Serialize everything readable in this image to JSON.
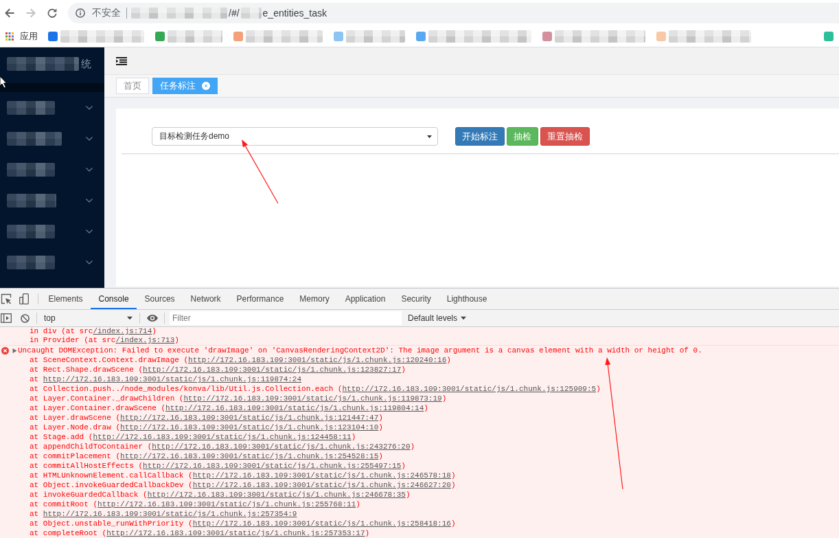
{
  "browser": {
    "security_label": "不安全",
    "url_segments": [
      {
        "kind": "redacted"
      },
      {
        "kind": "text",
        "text": "/#/"
      },
      {
        "kind": "redacted"
      },
      {
        "kind": "text",
        "text": "e_entities_task"
      }
    ],
    "bookmarks": [
      {
        "kind": "apps",
        "label": "应用"
      },
      {
        "kind": "redacted",
        "color": "#1a73e8"
      },
      {
        "kind": "redacted",
        "color": "#34a853"
      },
      {
        "kind": "redacted",
        "color": "#f4a07a"
      },
      {
        "kind": "redacted",
        "color": "#8cc4f4"
      },
      {
        "kind": "redacted",
        "color": "#5aa9f0"
      },
      {
        "kind": "redacted",
        "color": "#d4909c"
      },
      {
        "kind": "redacted",
        "color": "#f8c9a8"
      },
      {
        "kind": "icon_only",
        "color": "#2dbf9a"
      }
    ]
  },
  "sidebar": {
    "title_segments": [
      {
        "kind": "redacted"
      },
      {
        "kind": "text",
        "text": "统"
      }
    ],
    "menu": [
      {
        "kind": "redacted",
        "expanded": false
      },
      {
        "kind": "redacted",
        "expanded": false
      },
      {
        "kind": "redacted",
        "expanded": false
      },
      {
        "kind": "redacted",
        "expanded": false
      },
      {
        "kind": "redacted",
        "expanded": false
      },
      {
        "kind": "redacted",
        "expanded": false
      }
    ]
  },
  "page_tabs": [
    {
      "label": "首页",
      "selected": false,
      "closable": false
    },
    {
      "label": "任务标注",
      "selected": true,
      "closable": true
    }
  ],
  "task_select": {
    "value": "目标检测任务demo"
  },
  "actions": [
    {
      "label": "开始标注",
      "kind": "primary"
    },
    {
      "label": "抽检",
      "kind": "success"
    },
    {
      "label": "重置抽检",
      "kind": "danger"
    }
  ],
  "devtools": {
    "tabs": [
      {
        "label": "Elements",
        "selected": false
      },
      {
        "label": "Console",
        "selected": true
      },
      {
        "label": "Sources",
        "selected": false
      },
      {
        "label": "Network",
        "selected": false
      },
      {
        "label": "Performance",
        "selected": false
      },
      {
        "label": "Memory",
        "selected": false
      },
      {
        "label": "Application",
        "selected": false
      },
      {
        "label": "Security",
        "selected": false
      },
      {
        "label": "Lighthouse",
        "selected": false
      }
    ],
    "context": "top",
    "filter": {
      "placeholder": "Filter"
    },
    "levels": "Default levels",
    "console": {
      "previous_lines": [
        {
          "prefix": "in div (at src",
          "link": "/index.js:714",
          "suffix": ")"
        },
        {
          "prefix": "in Provider (at src",
          "link": "/index.js:713",
          "suffix": ")"
        }
      ],
      "error": {
        "expanded": false,
        "message": "Uncaught DOMException: Failed to execute 'drawImage' on 'CanvasRenderingContext2D': The image argument is a canvas element with a width or height of 0."
      },
      "stack": [
        {
          "prefix": "at SceneContext.Context.drawImage (",
          "link": "http://172.16.183.109:3001/static/js/1.chunk.js:120240:16",
          "suffix": ")"
        },
        {
          "prefix": "at Rect.Shape.drawScene (",
          "link": "http://172.16.183.109:3001/static/js/1.chunk.js:123827:17",
          "suffix": ")"
        },
        {
          "prefix": "at ",
          "link": "http://172.16.183.109:3001/static/js/1.chunk.js:119874:24"
        },
        {
          "prefix": "at Collection.push../node_modules/konva/lib/Util.js.Collection.each (",
          "link": "http://172.16.183.109:3001/static/js/1.chunk.js:125909:5",
          "suffix": ")"
        },
        {
          "prefix": "at Layer.Container._drawChildren (",
          "link": "http://172.16.183.109:3001/static/js/1.chunk.js:119873:19",
          "suffix": ")"
        },
        {
          "prefix": "at Layer.Container.drawScene (",
          "link": "http://172.16.183.109:3001/static/js/1.chunk.js:119804:14",
          "suffix": ")"
        },
        {
          "prefix": "at Layer.drawScene (",
          "link": "http://172.16.183.109:3001/static/js/1.chunk.js:121447:47",
          "suffix": ")"
        },
        {
          "prefix": "at Layer.Node.draw (",
          "link": "http://172.16.183.109:3001/static/js/1.chunk.js:123104:10",
          "suffix": ")"
        },
        {
          "prefix": "at Stage.add (",
          "link": "http://172.16.183.109:3001/static/js/1.chunk.js:124458:11",
          "suffix": ")"
        },
        {
          "prefix": "at appendChildToContainer (",
          "link": "http://172.16.183.109:3001/static/js/1.chunk.js:243276:20",
          "suffix": ")"
        },
        {
          "prefix": "at commitPlacement (",
          "link": "http://172.16.183.109:3001/static/js/1.chunk.js:254528:15",
          "suffix": ")"
        },
        {
          "prefix": "at commitAllHostEffects (",
          "link": "http://172.16.183.109:3001/static/js/1.chunk.js:255497:15",
          "suffix": ")"
        },
        {
          "prefix": "at HTMLUnknownElement.callCallback (",
          "link": "http://172.16.183.109:3001/static/js/1.chunk.js:246578:18",
          "suffix": ")"
        },
        {
          "prefix": "at Object.invokeGuardedCallbackDev (",
          "link": "http://172.16.183.109:3001/static/js/1.chunk.js:246627:20",
          "suffix": ")"
        },
        {
          "prefix": "at invokeGuardedCallback (",
          "link": "http://172.16.183.109:3001/static/js/1.chunk.js:246678:35",
          "suffix": ")"
        },
        {
          "prefix": "at commitRoot (",
          "link": "http://172.16.183.109:3001/static/js/1.chunk.js:255768:11",
          "suffix": ")"
        },
        {
          "prefix": "at ",
          "link": "http://172.16.183.109:3001/static/js/1.chunk.js:257354:9"
        },
        {
          "prefix": "at Object.unstable_runWithPriority (",
          "link": "http://172.16.183.109:3001/static/js/1.chunk.js:258418:16",
          "suffix": ")"
        },
        {
          "prefix": "at completeRoot (",
          "link": "http://172.16.183.109:3001/static/js/1.chunk.js:257353:17",
          "suffix": ")"
        }
      ]
    }
  }
}
